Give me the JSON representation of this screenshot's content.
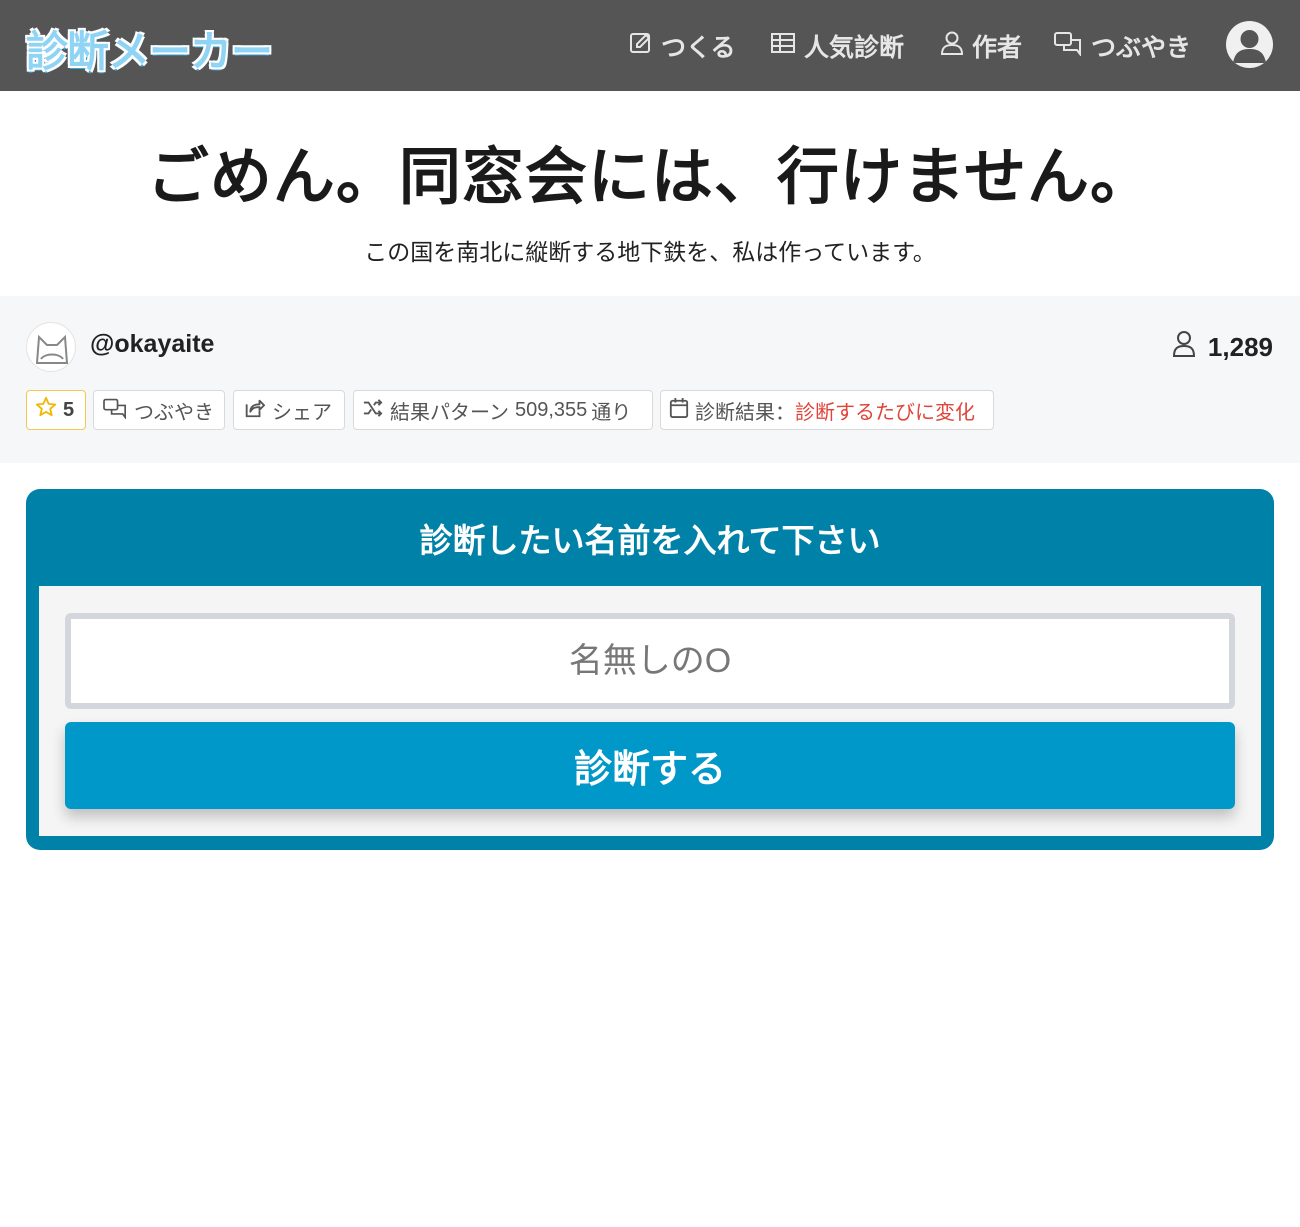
{
  "header": {
    "logo_text": "診断メーカー",
    "nav": [
      {
        "label": "つくる",
        "icon": "pencil-square-icon"
      },
      {
        "label": "人気診断",
        "icon": "table-icon"
      },
      {
        "label": "作者",
        "icon": "user-icon"
      },
      {
        "label": "つぶやき",
        "icon": "chat-bubbles-icon"
      }
    ],
    "account_icon": "account-avatar-icon"
  },
  "diagnosis": {
    "title": "ごめん。同窓会には、行けません。",
    "description": "この国を南北に縦断する地下鉄を、私は作っています。"
  },
  "author": {
    "handle": "@okayaite",
    "user_count": "1,289"
  },
  "chips": {
    "favorites": "5",
    "tweet": "つぶやき",
    "share": "シェア",
    "patterns_label": "結果パターン",
    "patterns_count": "509,355",
    "patterns_suffix": "通り",
    "result_label": "診断結果：",
    "result_value": "診断するたびに変化"
  },
  "form": {
    "heading": "診断したい名前を入れて下さい",
    "name_placeholder": "名無しのO",
    "submit_label": "診断する"
  },
  "colors": {
    "topbar": "#555555",
    "form_frame": "#0081a7",
    "submit": "#0097c9",
    "accent_red": "#e0443a",
    "star": "#f2c94c"
  }
}
